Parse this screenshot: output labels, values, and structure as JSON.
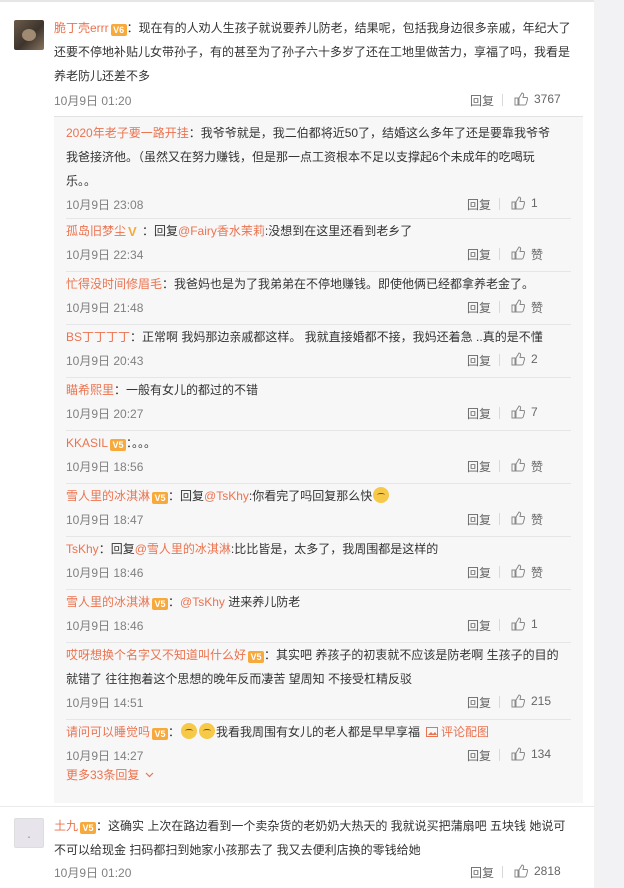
{
  "main1": {
    "username": "脆丁壳errr",
    "vip": "V6",
    "text_line1": "：现在有的人劝人生孩子就说要养儿防老，结果呢，包括我身边很多亲戚，年纪大了",
    "text_line2": "还要不停地补贴儿女带孙子，有的甚至为了孙子六十多岁了还在工地里做苦力，享福了吗，我看是",
    "text_line3": "养老防儿还差不多",
    "time": "10月9日 01:20",
    "reply_label": "回复",
    "likes": "3767"
  },
  "subs": [
    {
      "username": "2020年老子要一路开挂",
      "text1": "：我爷爷就是，我二伯都将近50了，结婚这么多年了还是要靠我爷爷",
      "text2": "我爸接济他。（虽然又在努力赚钱，但是那一点工资根本不足以支撑起6个未成年的吃喝玩",
      "text3": "乐。。",
      "time": "10月9日 23:08",
      "reply_label": "回复",
      "likes": "1"
    },
    {
      "username": "孤岛旧梦尘",
      "badge": "V",
      "mid": "：回复",
      "mention": "@Fairy香水茉莉",
      "text1": ":没想到在这里还看到老乡了",
      "time": "10月9日 22:34",
      "reply_label": "回复",
      "likes": "赞"
    },
    {
      "username": "忙得没时间修眉毛",
      "text1": "：我爸妈也是为了我弟弟在不停地赚钱。即使他俩已经都拿养老金了。",
      "time": "10月9日 21:48",
      "reply_label": "回复",
      "likes": "赞"
    },
    {
      "username": "BS丁丁丁丁",
      "text1": "：正常啊 我妈那边亲戚都这样。 我就直接婚都不接，我妈还着急 ..真的是不懂",
      "time": "10月9日 20:43",
      "reply_label": "回复",
      "likes": "2"
    },
    {
      "username": "瞄希熙里",
      "text1": "：一般有女儿的都过的不错",
      "time": "10月9日 20:27",
      "reply_label": "回复",
      "likes": "7"
    },
    {
      "username": "KKASIL",
      "vip": "V5",
      "text1": "：。。。",
      "time": "10月9日 18:56",
      "reply_label": "回复",
      "likes": "赞"
    },
    {
      "username": "雪人里的冰淇淋",
      "vip": "V5",
      "mid": "：回复",
      "mention": "@TsKhy",
      "text1": ":你看完了吗回复那么快",
      "time": "10月9日 18:47",
      "reply_label": "回复",
      "likes": "赞"
    },
    {
      "username": "TsKhy",
      "mid": "：回复",
      "mention": "@雪人里的冰淇淋",
      "text1": ":比比皆是，太多了，我周围都是这样的",
      "time": "10月9日 18:46",
      "reply_label": "回复",
      "likes": "赞"
    },
    {
      "username": "雪人里的冰淇淋",
      "vip": "V5",
      "mid": "：",
      "mention": "@TsKhy",
      "text1": " 进来养儿防老",
      "time": "10月9日 18:46",
      "reply_label": "回复",
      "likes": "1"
    },
    {
      "username": "哎呀想换个名字又不知道叫什么好",
      "vip": "V5",
      "text1": "：其实吧 养孩子的初衷就不应该是防老啊 生孩子的目的",
      "text2": "就错了 往往抱着这个思想的晚年反而凄苦 望周知 不接受杠精反驳",
      "time": "10月9日 14:51",
      "reply_label": "回复",
      "likes": "215"
    },
    {
      "username": "请问可以睡觉吗",
      "vip": "V5",
      "text1": "：",
      "text1b": "我看我周围有女儿的老人都是早早享福",
      "pic": "评论配图",
      "time": "10月9日 14:27",
      "reply_label": "回复",
      "likes": "134"
    }
  ],
  "more_replies": "更多33条回复",
  "main2": {
    "username": "土九",
    "vip": "V5",
    "text_line1": "：这确实 上次在路边看到一个卖杂货的老奶奶大热天的 我就说买把蒲扇吧 五块钱 她说可",
    "text_line2": "不可以给现金 扫码都扫到她家小孩那去了 我又去便利店换的零钱给她",
    "time": "10月9日 01:20",
    "reply_label": "回复",
    "likes": "2818"
  },
  "colors": {
    "accent": "#eb7350",
    "vip": "#f7a93b",
    "meta": "#808080"
  }
}
